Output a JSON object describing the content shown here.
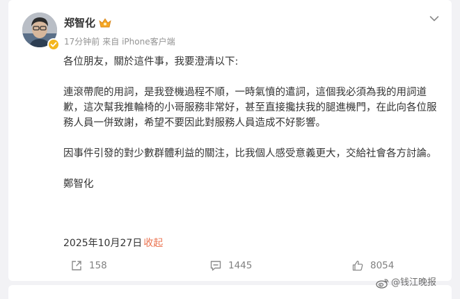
{
  "post": {
    "author": {
      "name": "郑智化",
      "avatar_icon": "avatar-photo",
      "badge_icon": "verified-badge-icon",
      "crown_icon": "crown-icon"
    },
    "meta": {
      "time": "17分钟前",
      "source": "来自 iPhone客户端"
    },
    "more_icon": "chevron-down-icon",
    "paragraphs": [
      "各位朋友，關於這件事，我要澄清以下:",
      "連滾帶爬的用詞，是我登機過程不順，一時氣憤的遣詞，這個我必須為我的用詞道歉，這次幫我推輪椅的小哥服務非常好，甚至直接攙扶我的腿進機門，在此向各位服務人員一併致謝，希望不要因此對服務人員造成不好影響。",
      "因事件引發的對少數群體利益的關注，比我個人感受意義更大，交給社會各方討論。",
      "鄭智化"
    ],
    "date": "2025年10月27日",
    "collapse_label": "收起",
    "actions": {
      "repost_count": "158",
      "comment_count": "1445",
      "like_count": "8054"
    }
  },
  "watermark": {
    "text": "@钱江晚报",
    "icon": "weibo-logo-icon"
  },
  "colors": {
    "accent_link": "#eb7350",
    "meta_text": "#939393",
    "badge": "#f4b61e",
    "background": "#f2f2f5"
  }
}
